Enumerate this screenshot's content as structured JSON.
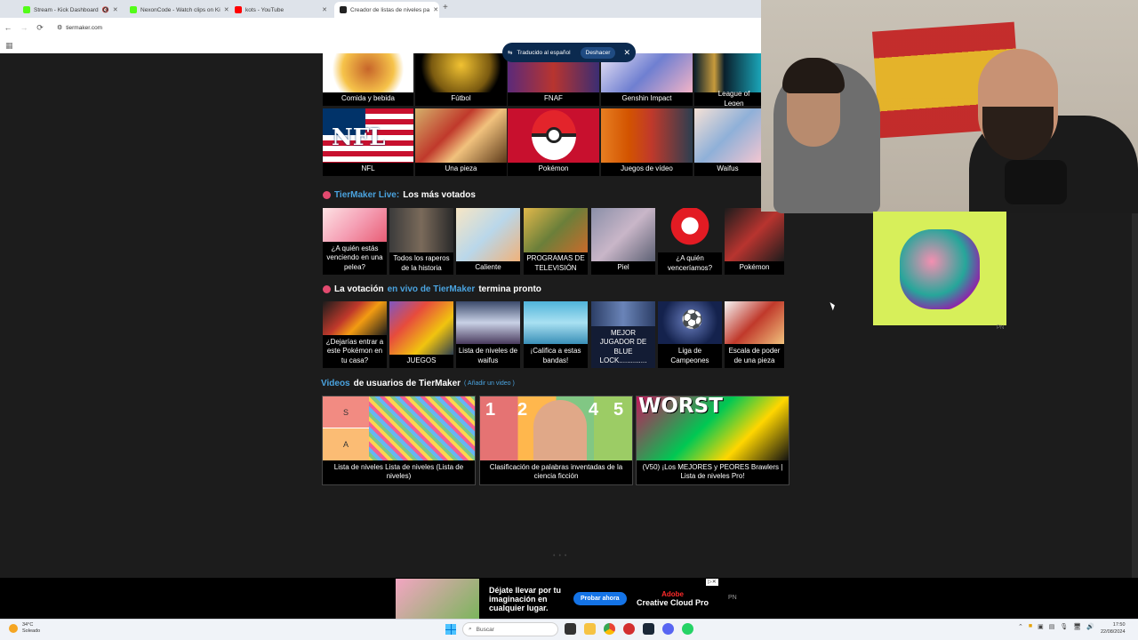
{
  "browser": {
    "tabs": [
      {
        "title": "Stream - Kick Dashboard",
        "color": "#53fc18"
      },
      {
        "title": "NexonCode - Watch clips on Ki",
        "color": "#53fc18"
      },
      {
        "title": "kots - YouTube",
        "color": "#ff0000"
      },
      {
        "title": "Creador de listas de niveles pa",
        "color": "#222222"
      }
    ],
    "url": "tiermaker.com"
  },
  "translate": {
    "label": "Traducido al español",
    "undo": "Deshacer"
  },
  "categories_row1": [
    "Comida y bebida",
    "Fútbol",
    "FNAF",
    "Genshin Impact",
    "League of Legen"
  ],
  "categories_row2": [
    "NFL",
    "Una pieza",
    "Pokémon",
    "Juegos de vídeo",
    "Waifus"
  ],
  "nfl_logo": "NFL",
  "live_section": {
    "brand": "TierMaker Live:",
    "rest": "Los más votados"
  },
  "live_items": [
    "¿A quién estás venciendo en una pelea?",
    "Todos los raperos de la historia",
    "Caliente",
    "PROGRAMAS DE TELEVISIÓN",
    "Piel",
    "¿A quién venceríamos?",
    "Pokémon"
  ],
  "vote_section": {
    "a": "La votación",
    "b": "en vivo de TierMaker",
    "c": "termina pronto"
  },
  "vote_items": [
    "¿Dejarías entrar a este Pokémon en tu casa?",
    "JUEGOS",
    "Lista de niveles de waifus",
    "¡Califica a estas bandas!",
    "MEJOR JUGADOR DE BLUE LOCK..............",
    "Liga de Campeones",
    "Escala de poder de una pieza"
  ],
  "videos_section": {
    "a": "Videos",
    "b": "de usuarios de TierMaker",
    "link": "( Añadir un video )"
  },
  "videos": [
    {
      "title": "Lista de niveles Lista de niveles (Lista de niveles)",
      "tiers": [
        "S",
        "A"
      ]
    },
    {
      "title": "Clasificación de palabras inventadas de la ciencia ficción",
      "numbers": [
        "1",
        "2",
        "4",
        "5"
      ]
    },
    {
      "title": "(V50) ¡Los MEJORES y PEORES Brawlers | Lista de niveles Pro!",
      "overlay": "WORST"
    }
  ],
  "right_ad_label": "PN",
  "bottom_ad": {
    "text": "Déjate llevar por tu imaginación en cualquier lugar.",
    "button": "Probar ahora",
    "brand_top": "Adobe",
    "brand": "Creative Cloud Pro",
    "label": "PN",
    "close": "▷✕"
  },
  "taskbar": {
    "weather_temp": "34°C",
    "weather_desc": "Soleado",
    "search": "Buscar",
    "time": "17:50",
    "date": "22/08/2024"
  }
}
